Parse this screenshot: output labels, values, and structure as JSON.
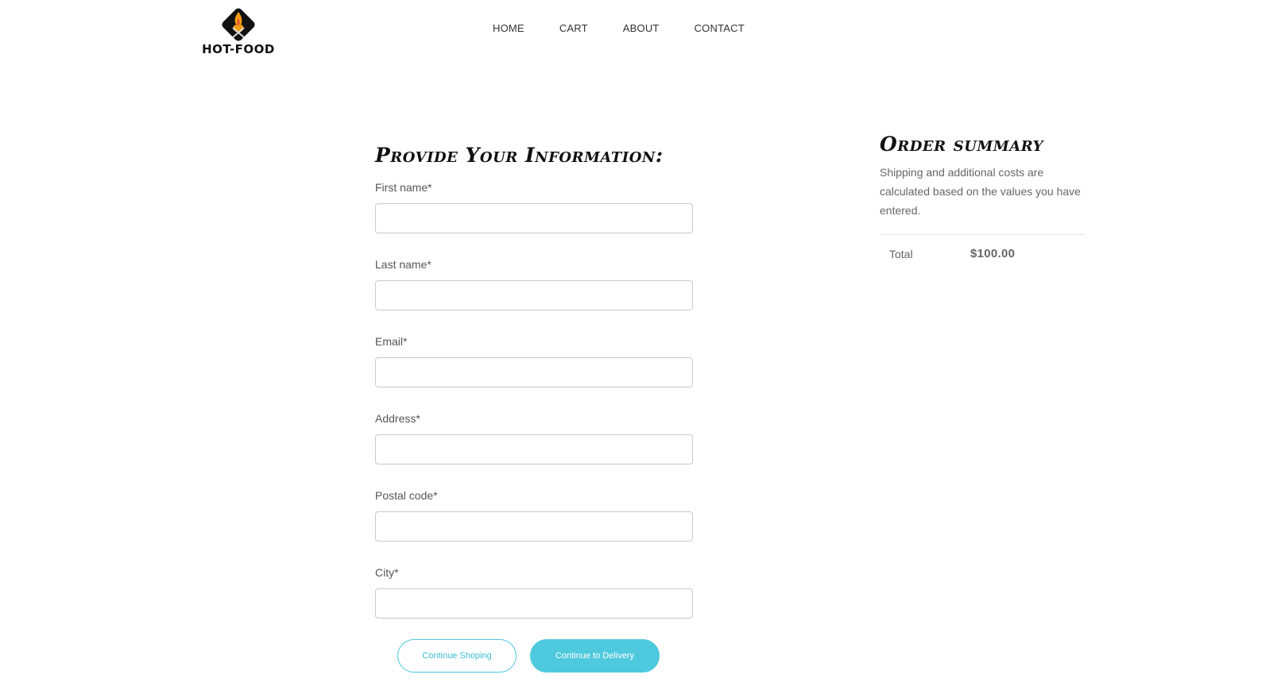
{
  "brand": {
    "name": "HOT-FOOD",
    "icon": "fire-fork-knife-logo",
    "accent_color": "#4fc9de"
  },
  "nav": {
    "items": [
      "HOME",
      "CART",
      "ABOUT",
      "CONTACT"
    ]
  },
  "form": {
    "title": "Provide Your Information:",
    "fields": [
      {
        "label": "First name*",
        "value": "",
        "placeholder": ""
      },
      {
        "label": "Last name*",
        "value": "",
        "placeholder": ""
      },
      {
        "label": "Email*",
        "value": "",
        "placeholder": ""
      },
      {
        "label": "Address*",
        "value": "",
        "placeholder": ""
      },
      {
        "label": "Postal code*",
        "value": "",
        "placeholder": ""
      },
      {
        "label": "City*",
        "value": "",
        "placeholder": ""
      }
    ]
  },
  "buttons": {
    "continue_shopping": "Continue Shoping",
    "continue_delivery": "Continue to Delivery"
  },
  "summary": {
    "title": "Order summary",
    "description": "Shipping and additional costs are calculated based on the values you have entered.",
    "total_label": "Total",
    "total_value": "$100.00"
  }
}
